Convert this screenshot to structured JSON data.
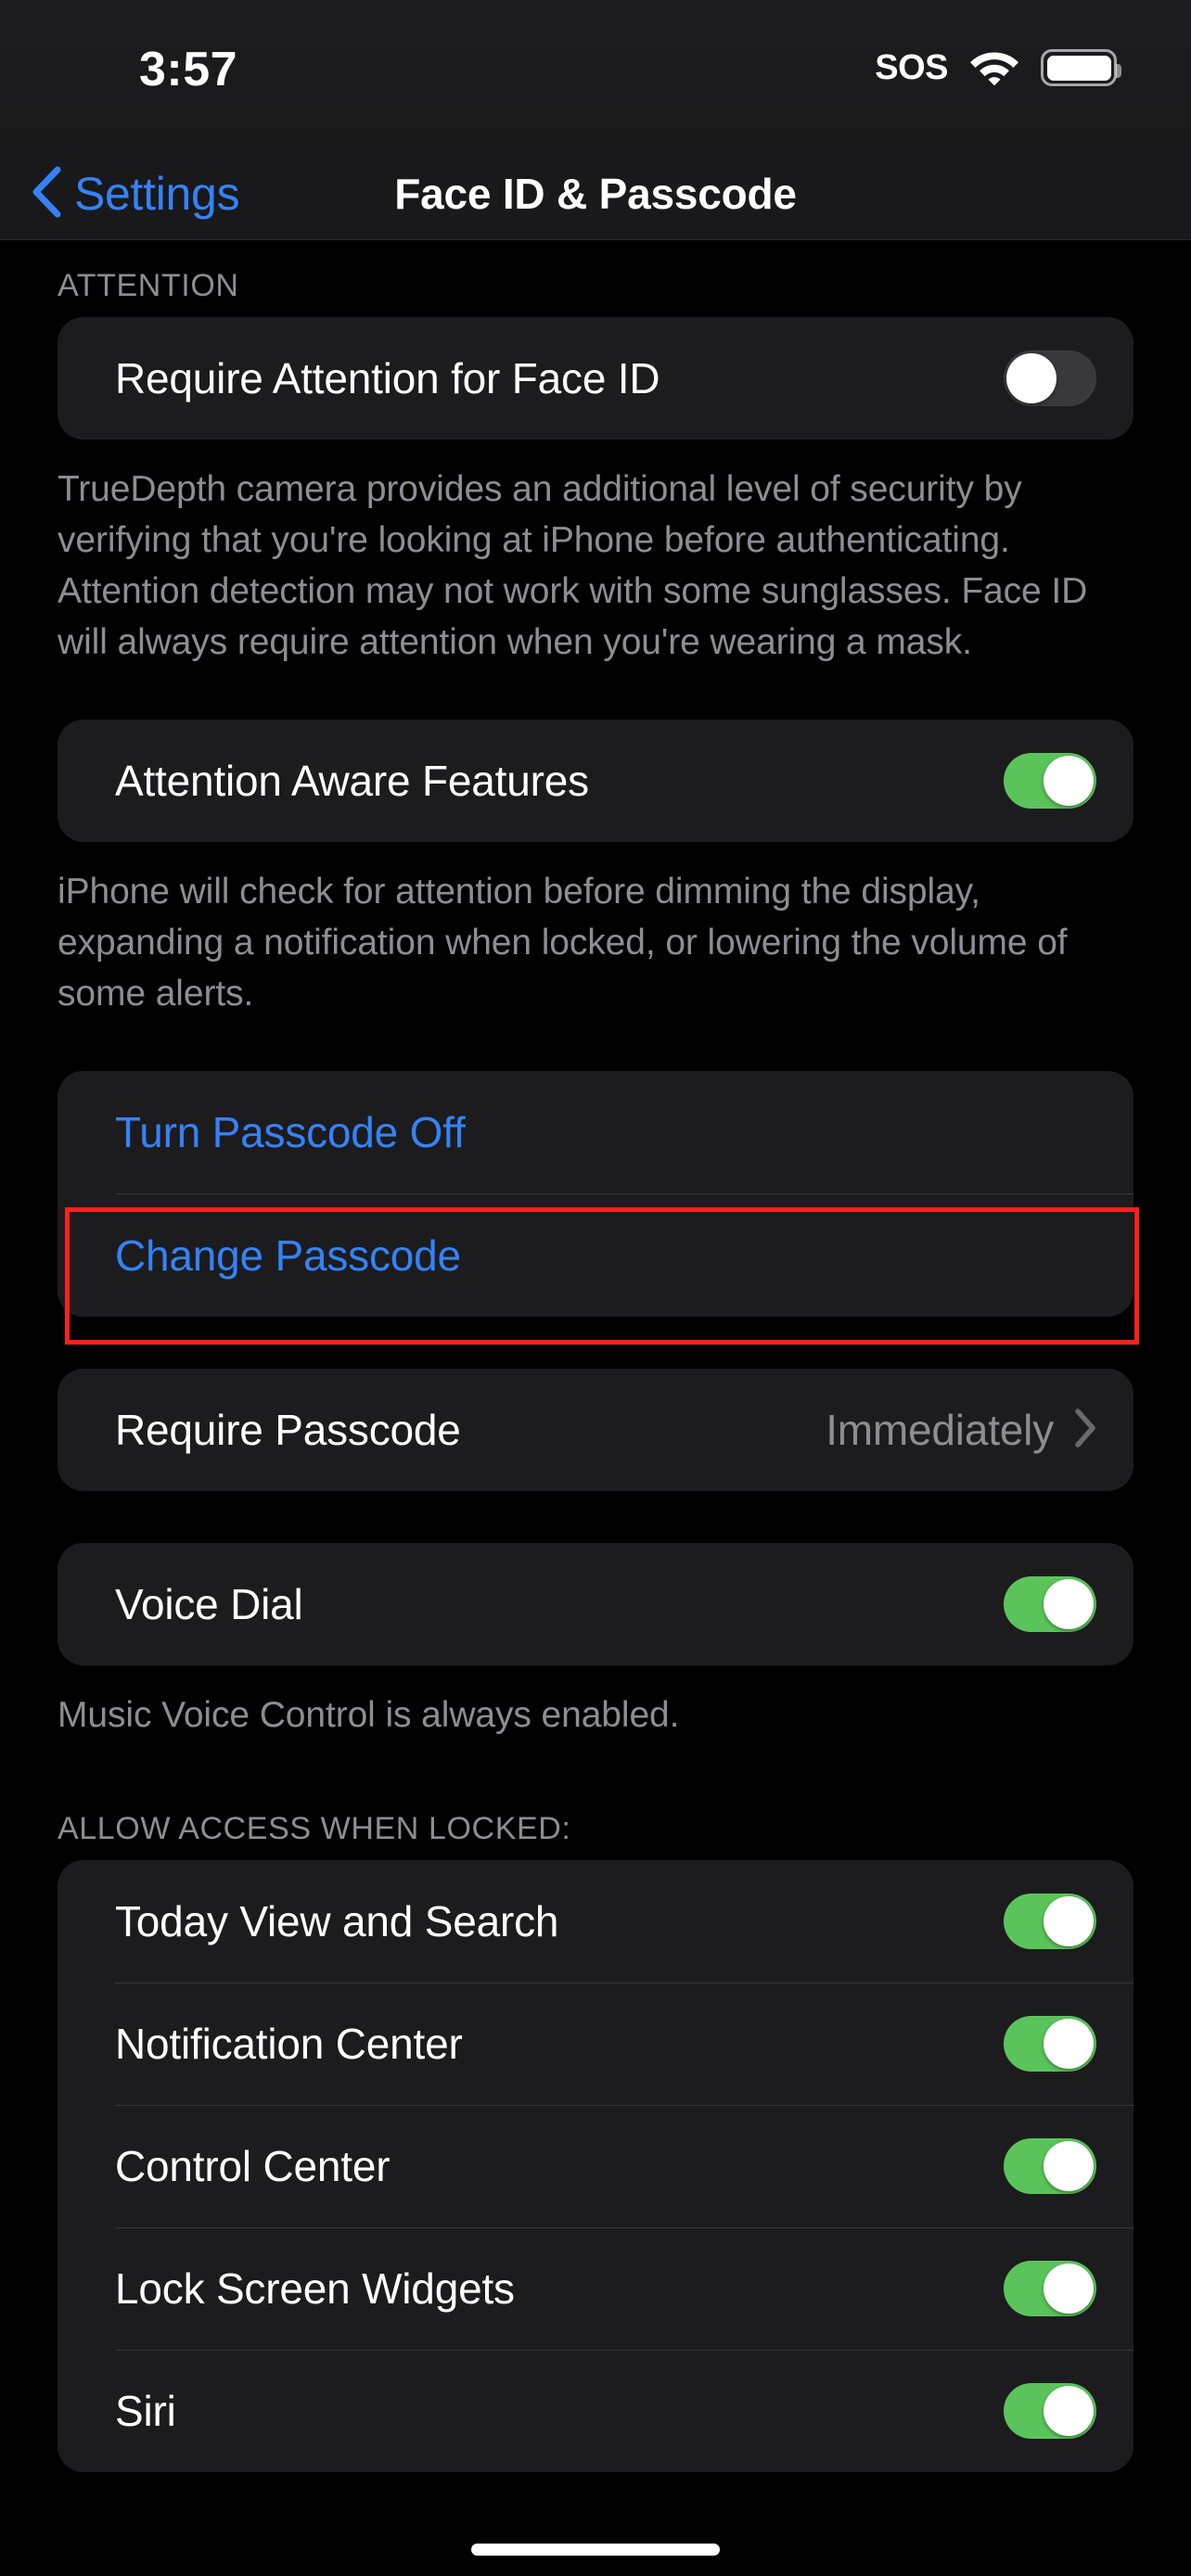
{
  "status_bar": {
    "time": "3:57",
    "sos": "SOS",
    "wifi_icon": "wifi-icon",
    "battery_icon": "battery-full-icon"
  },
  "nav": {
    "back_label": "Settings",
    "back_icon": "chevron-left-icon",
    "title": "Face ID & Passcode"
  },
  "sections": {
    "attention": {
      "header": "ATTENTION",
      "rows": [
        {
          "label": "Require Attention for Face ID",
          "toggle": "off"
        }
      ],
      "footer": "TrueDepth camera provides an additional level of security by verifying that you're looking at iPhone before authenticating. Attention detection may not work with some sunglasses. Face ID will always require attention when you're wearing a mask."
    },
    "attention_aware": {
      "rows": [
        {
          "label": "Attention Aware Features",
          "toggle": "on"
        }
      ],
      "footer": "iPhone will check for attention before dimming the display, expanding a notification when locked, or lowering the volume of some alerts."
    },
    "passcode_actions": {
      "rows": [
        {
          "label": "Turn Passcode Off"
        },
        {
          "label": "Change Passcode"
        }
      ]
    },
    "require_passcode": {
      "rows": [
        {
          "label": "Require Passcode",
          "value": "Immediately",
          "accessory": "chevron-right-icon"
        }
      ]
    },
    "voice_dial": {
      "rows": [
        {
          "label": "Voice Dial",
          "toggle": "on"
        }
      ],
      "footer": "Music Voice Control is always enabled."
    },
    "allow_access": {
      "header": "ALLOW ACCESS WHEN LOCKED:",
      "rows": [
        {
          "label": "Today View and Search",
          "toggle": "on"
        },
        {
          "label": "Notification Center",
          "toggle": "on"
        },
        {
          "label": "Control Center",
          "toggle": "on"
        },
        {
          "label": "Lock Screen Widgets",
          "toggle": "on"
        },
        {
          "label": "Siri",
          "toggle": "on"
        }
      ]
    }
  },
  "annotation": {
    "target": "Change Passcode",
    "color": "#ff1f1f"
  },
  "colors": {
    "accent_blue": "#3582f6",
    "toggle_on_green": "#5ac45a",
    "toggle_off_gray": "#39393c",
    "card_bg": "#1c1c1e",
    "page_bg": "#000000",
    "secondary_text": "#8d8d92"
  }
}
